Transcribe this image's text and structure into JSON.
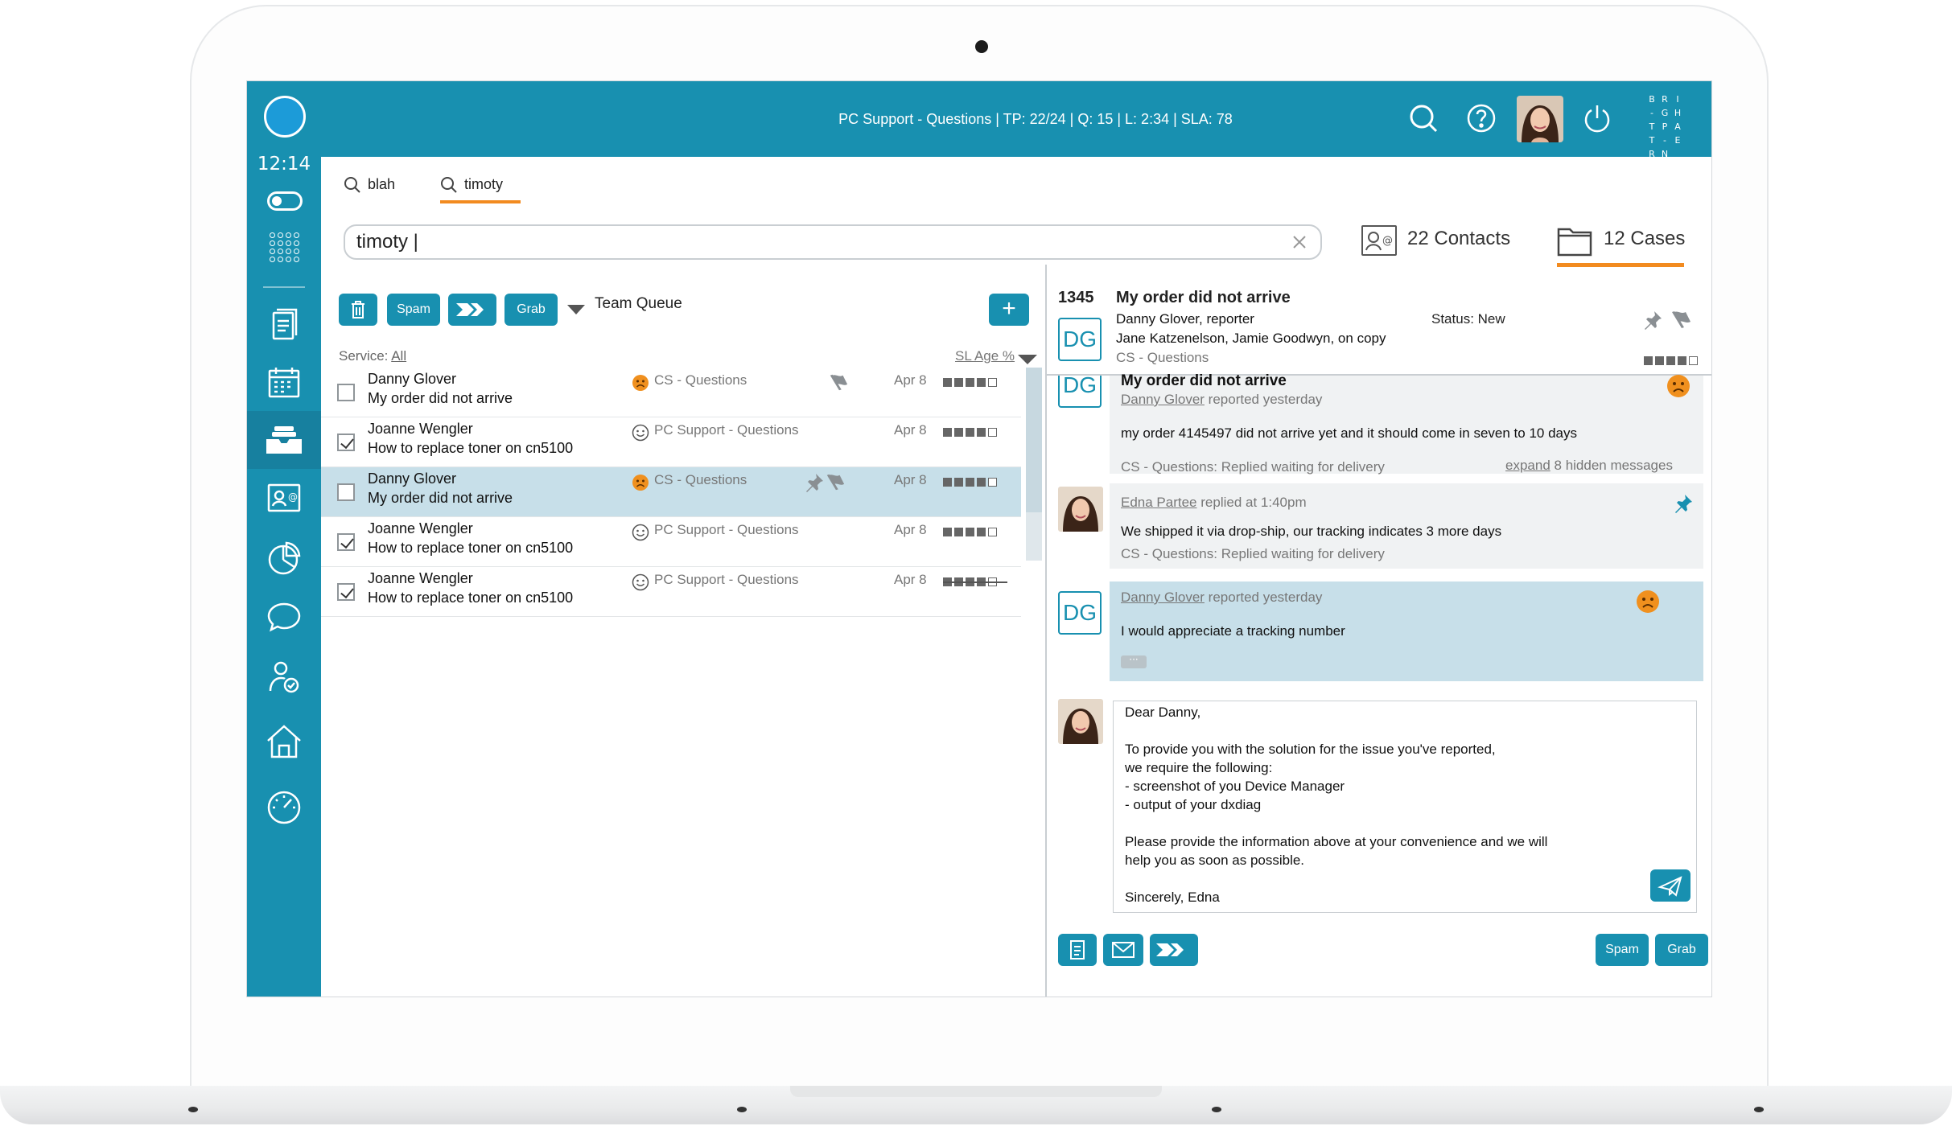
{
  "app": {
    "clock": "12:14",
    "status_line": "PC Support - Questions  |  TP: 22/24   |   Q: 15  |   L: 2:34   |   SLA: 78",
    "brand_rows": [
      [
        "B",
        "R",
        "I"
      ],
      [
        "-",
        "G",
        "H"
      ],
      [
        "T",
        "P",
        "A"
      ],
      [
        "T",
        "-",
        "E"
      ],
      [
        "R",
        "N",
        ""
      ]
    ]
  },
  "search": {
    "tabs": [
      {
        "label": "blah"
      },
      {
        "label": "timoty"
      }
    ],
    "query": "timoty |",
    "contacts_label": "22 Contacts",
    "cases_label": "12 Cases"
  },
  "list": {
    "toolbar": {
      "spam": "Spam",
      "grab": "Grab",
      "queue": "Team Queue"
    },
    "service_prefix": "Service:",
    "service_value": "All",
    "sl_age_label": "SL Age %",
    "rows": [
      {
        "name": "Danny Glover",
        "subject": "My order did not arrive",
        "service": "CS - Questions",
        "mood": "sad",
        "date": "Apr 8",
        "checked": false,
        "selected": false,
        "sl_filled": 4,
        "pin": false,
        "flag": true,
        "strike": false
      },
      {
        "name": "Joanne Wengler",
        "subject": "How to replace toner on cn5100",
        "service": "PC Support - Questions",
        "mood": "happy",
        "date": "Apr 8",
        "checked": true,
        "selected": false,
        "sl_filled": 4,
        "pin": false,
        "flag": false,
        "strike": false
      },
      {
        "name": "Danny Glover",
        "subject": "My order did not arrive",
        "service": "CS - Questions",
        "mood": "sad",
        "date": "Apr 8",
        "checked": false,
        "selected": true,
        "sl_filled": 4,
        "pin": true,
        "flag": true,
        "strike": false
      },
      {
        "name": "Joanne Wengler",
        "subject": "How to replace toner on cn5100",
        "service": "PC Support - Questions",
        "mood": "happy",
        "date": "Apr 8",
        "checked": true,
        "selected": false,
        "sl_filled": 4,
        "pin": false,
        "flag": false,
        "strike": false
      },
      {
        "name": "Joanne Wengler",
        "subject": "How to replace toner on cn5100",
        "service": "PC Support - Questions",
        "mood": "happy",
        "date": "Apr 8",
        "checked": true,
        "selected": false,
        "sl_filled": 4,
        "pin": false,
        "flag": false,
        "strike": true
      }
    ]
  },
  "case": {
    "number": "1345",
    "title": "My order did not arrive",
    "reporter": "Danny Glover, reporter",
    "copy": "Jane Katzenelson, Jamie Goodwyn, on copy",
    "service": "CS - Questions",
    "status": "Status: New",
    "initials": "DG",
    "messages": [
      {
        "partial_title": "My order did not arrive",
        "author": "Danny Glover",
        "meta": "reported yesterday",
        "body": "my order 4145497 did not arrive yet and it should come in seven to 10 days",
        "footer": "CS - Questions: Replied waiting for delivery",
        "expand_link": "expand",
        "expand_rest": "8 hidden messages"
      },
      {
        "author": "Edna Partee",
        "meta": "replied at 1:40pm",
        "body": "We shipped it via drop-ship, our tracking indicates 3 more days",
        "footer": "CS - Questions: Replied waiting for delivery"
      },
      {
        "author": "Danny Glover",
        "meta": "reported yesterday",
        "body": "I would appreciate a tracking number",
        "ellipsis": "···"
      }
    ],
    "reply_text": "Dear Danny,\n\nTo provide you with the solution for the issue you've reported,\nwe require the following:\n- screenshot of you Device Manager\n- output of your dxdiag\n\nPlease provide the information above at your convenience and we will\nhelp you as soon as possible.\n\nSincerely, Edna",
    "actions": {
      "spam": "Spam",
      "grab": "Grab"
    }
  },
  "colors": {
    "primary": "#1890b0",
    "accent": "#f28b20",
    "selected_row": "#c7dfe9",
    "sad_face": "#f0901e"
  }
}
